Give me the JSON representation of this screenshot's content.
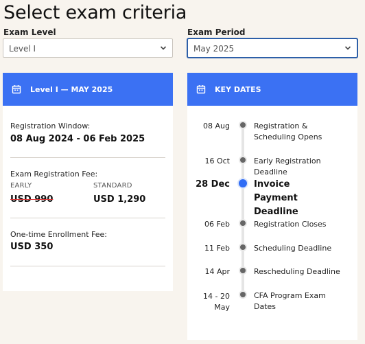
{
  "page_title": "Select exam criteria",
  "exam_level": {
    "label": "Exam Level",
    "value": "Level I"
  },
  "exam_period": {
    "label": "Exam Period",
    "value": "May 2025"
  },
  "left_card": {
    "header": "Level I — MAY 2025",
    "registration_window_label": "Registration Window:",
    "registration_window_value": "08 Aug 2024 - 06 Feb 2025",
    "fee_label": "Exam Registration Fee:",
    "early_label": "EARLY",
    "early_value": "USD 990",
    "standard_label": "STANDARD",
    "standard_value": "USD 1,290",
    "enrollment_label": "One-time Enrollment Fee:",
    "enrollment_value": "USD 350"
  },
  "right_card": {
    "header": "KEY DATES",
    "items": [
      {
        "date": "08 Aug",
        "text": "Registration & Scheduling Opens"
      },
      {
        "date": "16 Oct",
        "text": "Early Registration Deadline"
      },
      {
        "date": "28 Dec",
        "text": "Invoice Payment Deadline"
      },
      {
        "date": "06 Feb",
        "text": "Registration Closes"
      },
      {
        "date": "11 Feb",
        "text": "Scheduling Deadline"
      },
      {
        "date": "14 Apr",
        "text": "Rescheduling Deadline"
      },
      {
        "date": "14 - 20 May",
        "text": "CFA Program Exam Dates"
      }
    ]
  },
  "colors": {
    "accent": "#3b71f3",
    "background": "#f8f4ee"
  }
}
